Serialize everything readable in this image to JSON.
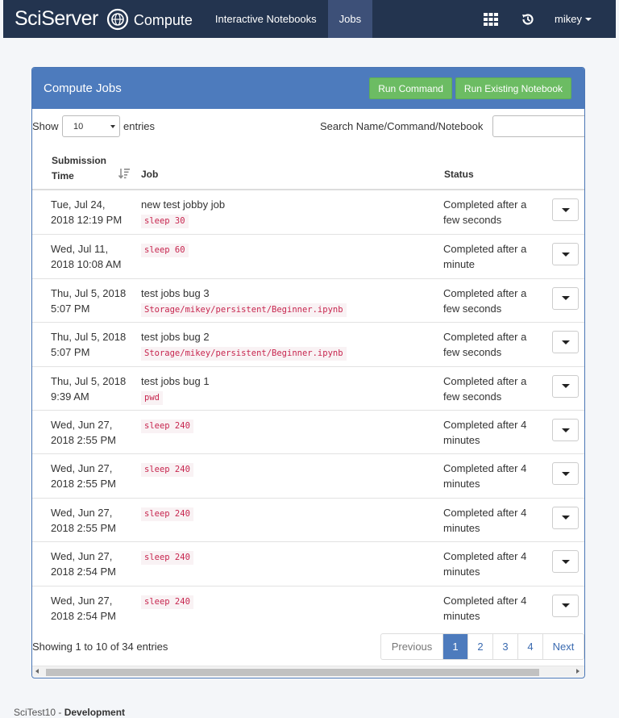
{
  "navbar": {
    "brand_sci": "SciServer",
    "brand_compute": "Compute",
    "links": [
      {
        "label": "Interactive Notebooks",
        "active": false
      },
      {
        "label": "Jobs",
        "active": true
      }
    ],
    "user": "mikey"
  },
  "panel": {
    "title": "Compute Jobs",
    "run_command_label": "Run Command",
    "run_notebook_label": "Run Existing Notebook"
  },
  "controls": {
    "show_label": "Show",
    "length_value": "10",
    "entries_label": "entries",
    "search_label": "Search Name/Command/Notebook"
  },
  "table": {
    "headers": {
      "submission_line1": "Submission",
      "submission_line2": "Time",
      "job": "Job",
      "status": "Status"
    },
    "rows": [
      {
        "time1": "Tue, Jul 24,",
        "time2": "2018 12:19 PM",
        "name": "new test jobby job",
        "cmd": "sleep 30",
        "status1": "Completed after a",
        "status2": "few seconds"
      },
      {
        "time1": "Wed, Jul 11,",
        "time2": "2018 10:08 AM",
        "name": "",
        "cmd": "sleep 60",
        "status1": "Completed after a",
        "status2": "minute"
      },
      {
        "time1": "Thu, Jul 5, 2018",
        "time2": "5:07 PM",
        "name": "test jobs bug 3",
        "cmd": "Storage/mikey/persistent/Beginner.ipynb",
        "status1": "Completed after a",
        "status2": "few seconds"
      },
      {
        "time1": "Thu, Jul 5, 2018",
        "time2": "5:07 PM",
        "name": "test jobs bug 2",
        "cmd": "Storage/mikey/persistent/Beginner.ipynb",
        "status1": "Completed after a",
        "status2": "few seconds"
      },
      {
        "time1": "Thu, Jul 5, 2018",
        "time2": "9:39 AM",
        "name": "test jobs bug 1",
        "cmd": "pwd",
        "status1": "Completed after a",
        "status2": "few seconds"
      },
      {
        "time1": "Wed, Jun 27,",
        "time2": "2018 2:55 PM",
        "name": "",
        "cmd": "sleep 240",
        "status1": "Completed after 4",
        "status2": "minutes"
      },
      {
        "time1": "Wed, Jun 27,",
        "time2": "2018 2:55 PM",
        "name": "",
        "cmd": "sleep 240",
        "status1": "Completed after 4",
        "status2": "minutes"
      },
      {
        "time1": "Wed, Jun 27,",
        "time2": "2018 2:55 PM",
        "name": "",
        "cmd": "sleep 240",
        "status1": "Completed after 4",
        "status2": "minutes"
      },
      {
        "time1": "Wed, Jun 27,",
        "time2": "2018 2:54 PM",
        "name": "",
        "cmd": "sleep 240",
        "status1": "Completed after 4",
        "status2": "minutes"
      },
      {
        "time1": "Wed, Jun 27,",
        "time2": "2018 2:54 PM",
        "name": "",
        "cmd": "sleep 240",
        "status1": "Completed after 4",
        "status2": "minutes"
      }
    ]
  },
  "info": "Showing 1 to 10 of 34 entries",
  "pagination": {
    "previous": "Previous",
    "pages": [
      "1",
      "2",
      "3",
      "4"
    ],
    "active_page": "1",
    "next": "Next"
  },
  "footer": {
    "prefix": "SciTest10 - ",
    "env": "Development"
  },
  "colors": {
    "navbar": "#23344f",
    "panel_header": "#4d7bbd",
    "button_green": "#6cbc63",
    "code_text": "#c7254e"
  }
}
